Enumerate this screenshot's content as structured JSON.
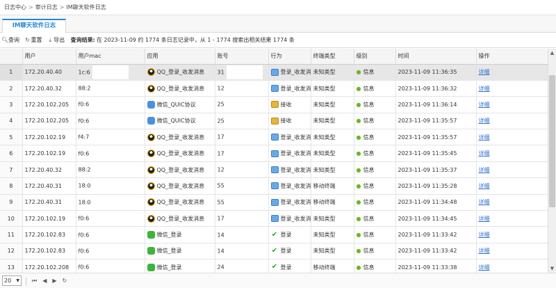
{
  "breadcrumb": [
    "日志中心",
    "审计日志",
    "IM聊天软件日志"
  ],
  "tab": "IM聊天软件日志",
  "toolbar": {
    "query": "查询",
    "reset": "重置",
    "export": "导出",
    "result_label": "查询结果:",
    "result_text": "在 2023-11-09 约 1774 条日志记录中，从 1 - 1774 搜索出相关结果 1774 条"
  },
  "columns": [
    "",
    "用户",
    "用户mac",
    "应用",
    "账号",
    "行为",
    "终端类型",
    "级别",
    "时间",
    "操作"
  ],
  "rows": [
    {
      "n": "1",
      "user": "172.20.40.40",
      "mac": "1c:6",
      "app": "QQ_登录_收发消息",
      "appicon": "qq",
      "acct": "31",
      "action": "登录_收发消息",
      "acticon": "send",
      "term": "未知类型",
      "level": "信息",
      "time": "2023-11-09 11:36:35",
      "op": "详细"
    },
    {
      "n": "2",
      "user": "172.20.40.32",
      "mac": "88:2",
      "app": "QQ_登录_收发消息",
      "appicon": "qq",
      "acct": "12",
      "action": "登录_收发消息",
      "acticon": "send",
      "term": "未知类型",
      "level": "信息",
      "time": "2023-11-09 11:36:32",
      "op": "详细"
    },
    {
      "n": "3",
      "user": "172.20.102.205",
      "mac": "f0:6",
      "app": "微信_QUIC协议",
      "appicon": "quic",
      "acct": "25",
      "action": "接收",
      "acticon": "recv",
      "term": "未知类型",
      "level": "信息",
      "time": "2023-11-09 11:36:14",
      "op": "详细"
    },
    {
      "n": "4",
      "user": "172.20.102.205",
      "mac": "f0:6",
      "app": "微信_QUIC协议",
      "appicon": "quic",
      "acct": "25",
      "action": "接收",
      "acticon": "recv",
      "term": "未知类型",
      "level": "信息",
      "time": "2023-11-09 11:35:57",
      "op": "详细"
    },
    {
      "n": "5",
      "user": "172.20.102.19",
      "mac": "f4:7",
      "app": "QQ_登录_收发消息",
      "appicon": "qq",
      "acct": "17",
      "action": "登录_收发消息",
      "acticon": "send",
      "term": "未知类型",
      "level": "信息",
      "time": "2023-11-09 11:35:57",
      "op": "详细"
    },
    {
      "n": "6",
      "user": "172.20.102.19",
      "mac": "f0:6",
      "app": "QQ_登录_收发消息",
      "appicon": "qq",
      "acct": "17",
      "action": "登录_收发消息",
      "acticon": "send",
      "term": "未知类型",
      "level": "信息",
      "time": "2023-11-09 11:35:45",
      "op": "详细"
    },
    {
      "n": "7",
      "user": "172.20.40.32",
      "mac": "88:2",
      "app": "QQ_登录_收发消息",
      "appicon": "qq",
      "acct": "12",
      "action": "登录_收发消息",
      "acticon": "send",
      "term": "未知类型",
      "level": "信息",
      "time": "2023-11-09 11:35:37",
      "op": "详细"
    },
    {
      "n": "8",
      "user": "172.20.40.31",
      "mac": "18:0",
      "app": "QQ_登录_收发消息",
      "appicon": "qq",
      "acct": "55",
      "action": "登录_收发消息",
      "acticon": "send",
      "term": "移动终端",
      "level": "信息",
      "time": "2023-11-09 11:35:28",
      "op": "详细"
    },
    {
      "n": "9",
      "user": "172.20.40.31",
      "mac": "18:0",
      "app": "QQ_登录_收发消息",
      "appicon": "qq",
      "acct": "55",
      "action": "登录_收发消息",
      "acticon": "send",
      "term": "移动终端",
      "level": "信息",
      "time": "2023-11-09 11:34:48",
      "op": "详细"
    },
    {
      "n": "10",
      "user": "172.20.102.19",
      "mac": "f0:6",
      "app": "QQ_登录_收发消息",
      "appicon": "qq",
      "acct": "17",
      "action": "登录_收发消息",
      "acticon": "send",
      "term": "未知类型",
      "level": "信息",
      "time": "2023-11-09 11:34:45",
      "op": "详细"
    },
    {
      "n": "11",
      "user": "172.20.102.83",
      "mac": "f0:6",
      "app": "微信_登录",
      "appicon": "wx",
      "acct": "14",
      "action": "登录",
      "acticon": "login",
      "term": "未知类型",
      "level": "信息",
      "time": "2023-11-09 11:33:42",
      "op": "详细"
    },
    {
      "n": "12",
      "user": "172.20.102.83",
      "mac": "f0:6",
      "app": "微信_登录",
      "appicon": "wx",
      "acct": "14",
      "action": "登录",
      "acticon": "login",
      "term": "未知类型",
      "level": "信息",
      "time": "2023-11-09 11:33:42",
      "op": "详细"
    },
    {
      "n": "13",
      "user": "172.20.102.208",
      "mac": "f0:6",
      "app": "微信_登录",
      "appicon": "wx",
      "acct": "24",
      "action": "登录",
      "acticon": "login",
      "term": "移动终端",
      "level": "信息",
      "time": "2023-11-09 11:33:38",
      "op": "详细"
    }
  ],
  "footer": {
    "page_size": "20"
  },
  "colors": {
    "accent": "#2b87d0",
    "link": "#2b6fcb"
  }
}
